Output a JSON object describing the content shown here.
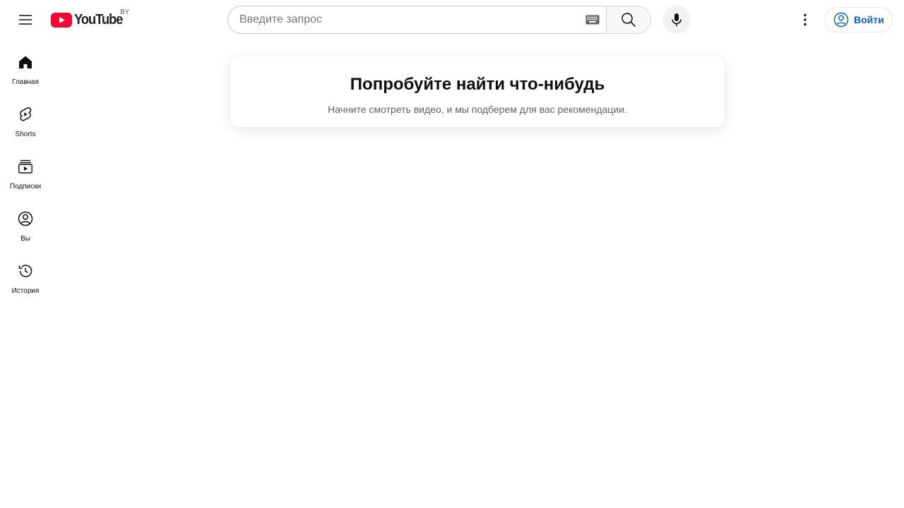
{
  "header": {
    "logo_text": "YouTube",
    "country_code": "BY",
    "search_placeholder": "Введите запрос",
    "search_value": "",
    "signin_label": "Войти"
  },
  "sidebar": {
    "items": [
      {
        "label": "Главная",
        "icon": "home-icon"
      },
      {
        "label": "Shorts",
        "icon": "shorts-icon"
      },
      {
        "label": "Подписки",
        "icon": "subscriptions-icon"
      },
      {
        "label": "Вы",
        "icon": "you-icon"
      },
      {
        "label": "История",
        "icon": "history-icon"
      }
    ]
  },
  "main": {
    "prompt_title": "Попробуйте найти что-нибудь",
    "prompt_subtitle": "Начните смотреть видео, и мы подберем для вас рекомендации."
  },
  "colors": {
    "brand_red": "#ff0033",
    "link_blue": "#065fd4",
    "text_primary": "#0f0f0f",
    "text_secondary": "#606060"
  }
}
